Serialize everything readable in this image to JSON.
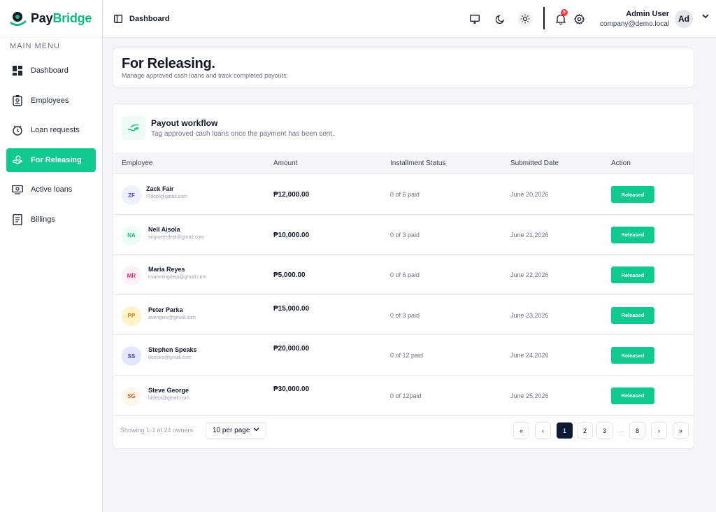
{
  "brand": {
    "part1": "Pay",
    "part2": "Bridge"
  },
  "sidebar": {
    "caption": "MAIN MENU",
    "items": [
      {
        "label": "Dashboard",
        "icon": "dashboard-icon"
      },
      {
        "label": "Employees",
        "icon": "id-badge-icon"
      },
      {
        "label": "Loan requests",
        "icon": "money-clock-icon"
      },
      {
        "label": "For Releasing",
        "icon": "hand-money-icon",
        "active": true
      },
      {
        "label": "Active loans",
        "icon": "cash-icon"
      },
      {
        "label": "Billings",
        "icon": "receipt-icon"
      }
    ]
  },
  "header": {
    "title": "Dashboard",
    "notifications": "5",
    "user_name": "Admin User",
    "user_email": "company@demo.local",
    "avatar": "Ad"
  },
  "page": {
    "title": "For Releasing.",
    "subtitle": "Manage approved cash loans and track completed payouts."
  },
  "workflow": {
    "title": "Payout workflow",
    "subtitle": "Tag approved cash loans once the payment has been sent."
  },
  "table": {
    "columns": [
      "Employee",
      "Amount",
      "Installment Status",
      "Submitted Date",
      "Action"
    ],
    "rows": [
      {
        "initials": "ZF",
        "name": "Zack Fair",
        "email": "ITdept@gmail.com",
        "amount": "₱12,000.00",
        "status": "0 of 6 paid",
        "date": "June 20,2026",
        "action": "Released",
        "av_bg": "#eef2ff",
        "av_fg": "#4f46e5"
      },
      {
        "initials": "NA",
        "name": "Neil Aisola",
        "email": "engineerdept@gmail.com",
        "amount": "₱10,000.00",
        "status": "0 of 3 paid",
        "date": "June 21,2026",
        "action": "Released",
        "av_bg": "#ecfdf5",
        "av_fg": "#10b981"
      },
      {
        "initials": "MR",
        "name": "Maria Reyes",
        "email": "marketingdept@gmail.com",
        "amount": "₱5,000.00",
        "status": "0 of 6 paid",
        "date": "June 22,2026",
        "action": "Released",
        "av_bg": "#fdf2f8",
        "av_fg": "#db2777"
      },
      {
        "initials": "PP",
        "name": "Peter Parka",
        "email": "avengers@gmail.com",
        "amount": "₱15,000.00",
        "status": "0 of 3 paid",
        "date": "June 23,2026",
        "action": "Released",
        "av_bg": "#fef3c7",
        "av_fg": "#d97706"
      },
      {
        "initials": "SS",
        "name": "Stephen Speaks",
        "email": "doctors@gmail.com",
        "amount": "₱20,000.00",
        "status": "0 of 12 paid",
        "date": "June 24,2026",
        "action": "Released",
        "av_bg": "#e0e7ff",
        "av_fg": "#4338ca"
      },
      {
        "initials": "SG",
        "name": "Steve George",
        "email": "hrdept@gmail.com",
        "amount": "₱30,000.00",
        "status": "0 of 12paid",
        "date": "June 25,2026",
        "action": "Released",
        "av_bg": "#fff7ed",
        "av_fg": "#ea580c"
      }
    ]
  },
  "pagination": {
    "showing": "Showing 1-3 of 24 owners",
    "per_page": "10 per page",
    "first": "«",
    "prev": "‹",
    "pages": [
      "1",
      "2",
      "3"
    ],
    "ellipsis": "...",
    "last_page": "8",
    "next": "›",
    "last": "»",
    "current": "1"
  },
  "colors": {
    "accent": "#10c98f",
    "brand_dark": "#111827",
    "active_page": "#0b1b33"
  }
}
